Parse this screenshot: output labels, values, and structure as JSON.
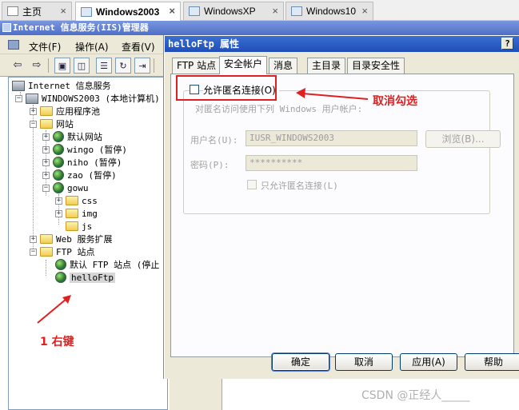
{
  "vm_tabs": [
    {
      "label": "主页",
      "active": false
    },
    {
      "label": "Windows2003",
      "active": true
    },
    {
      "label": "WindowsXP",
      "active": false
    },
    {
      "label": "Windows10",
      "active": false
    }
  ],
  "iis": {
    "title": "Internet 信息服务(IIS)管理器",
    "menu": [
      "文件(F)",
      "操作(A)",
      "查看(V)"
    ],
    "toolbar_icons": [
      "back-icon",
      "forward-icon",
      "up-icon",
      "show-tree-icon",
      "properties-icon",
      "refresh-icon",
      "export-icon",
      "help-icon",
      "console-help-icon"
    ],
    "tree": [
      {
        "label": "Internet 信息服务",
        "icon": "computer"
      },
      {
        "label": "WINDOWS2003 (本地计算机)",
        "icon": "computer"
      },
      {
        "label": "应用程序池",
        "icon": "folder"
      },
      {
        "label": "网站",
        "icon": "folder"
      },
      {
        "label": "默认网站",
        "icon": "globe"
      },
      {
        "label": "wingo (暂停)",
        "icon": "globe"
      },
      {
        "label": "niho (暂停)",
        "icon": "globe"
      },
      {
        "label": "zao (暂停)",
        "icon": "globe"
      },
      {
        "label": "gowu",
        "icon": "globe"
      },
      {
        "label": "css",
        "icon": "folder"
      },
      {
        "label": "img",
        "icon": "folder"
      },
      {
        "label": "js",
        "icon": "folder"
      },
      {
        "label": "Web 服务扩展",
        "icon": "folder"
      },
      {
        "label": "FTP 站点",
        "icon": "folder"
      },
      {
        "label": "默认 FTP 站点 (停止",
        "icon": "globe"
      },
      {
        "label": "helloFtp",
        "icon": "globe",
        "selected": true
      }
    ]
  },
  "dialog": {
    "title": "helloFtp 属性",
    "help_btn": "?",
    "close_btn": "×",
    "tabs": [
      "FTP 站点",
      "安全帐户",
      "消息",
      "主目录",
      "目录安全性"
    ],
    "active_tab": "安全帐户",
    "allow_anonymous": {
      "label": "允许匿名连接(O)",
      "checked": false
    },
    "group_caption": "对匿名访问使用下列 Windows 用户帐户:",
    "username_label": "用户名(U):",
    "username_value": "IUSR_WINDOWS2003",
    "browse_btn": "浏览(B)...",
    "password_label": "密码(P):",
    "password_value": "**********",
    "only_anonymous": {
      "label": "只允许匿名连接(L)",
      "checked": false
    },
    "buttons": {
      "ok": "确定",
      "cancel": "取消",
      "apply": "应用(A)",
      "help": "帮助"
    }
  },
  "annotations": {
    "uncheck": "取消勾选",
    "right_click": "1 右键",
    "color": "#e02020"
  },
  "watermark": "CSDN @正经人_____"
}
